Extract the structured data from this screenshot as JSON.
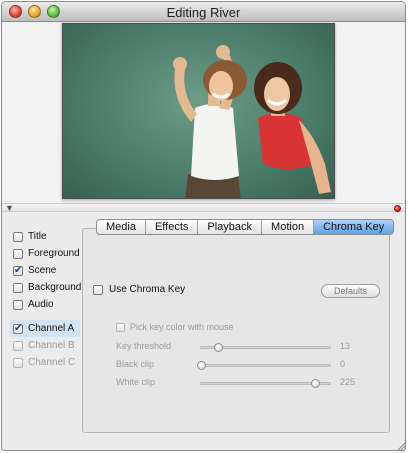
{
  "window": {
    "title": "Editing River"
  },
  "tracks": [
    {
      "label": "Title",
      "checked": false,
      "disabled": false,
      "selected": false
    },
    {
      "label": "Foreground",
      "checked": false,
      "disabled": false,
      "selected": false
    },
    {
      "label": "Scene",
      "checked": true,
      "disabled": false,
      "selected": false
    },
    {
      "label": "Background",
      "checked": false,
      "disabled": false,
      "selected": false
    },
    {
      "label": "Audio",
      "checked": false,
      "disabled": false,
      "selected": false
    },
    {
      "label": "Channel A",
      "checked": true,
      "disabled": false,
      "selected": true
    },
    {
      "label": "Channel B",
      "checked": false,
      "disabled": true,
      "selected": false
    },
    {
      "label": "Channel C",
      "checked": false,
      "disabled": true,
      "selected": false
    }
  ],
  "tabs": [
    {
      "label": "Media",
      "active": false
    },
    {
      "label": "Effects",
      "active": false
    },
    {
      "label": "Playback",
      "active": false
    },
    {
      "label": "Motion",
      "active": false
    },
    {
      "label": "Chroma Key",
      "active": true
    }
  ],
  "chroma": {
    "use_label": "Use Chroma Key",
    "use_checked": false,
    "defaults_label": "Defaults",
    "pick_label": "Pick key color with mouse",
    "sliders": [
      {
        "name": "key-threshold",
        "label": "Key threshold",
        "value": "13",
        "level": 0.13
      },
      {
        "name": "black-clip",
        "label": "Black clip",
        "value": "0",
        "level": 0.0
      },
      {
        "name": "white-clip",
        "label": "White clip",
        "value": "225",
        "level": 0.88
      }
    ]
  },
  "colors": {
    "accent": "#5da3ea",
    "selection": "#d4e2f6",
    "backdrop": "#4a7b68"
  }
}
